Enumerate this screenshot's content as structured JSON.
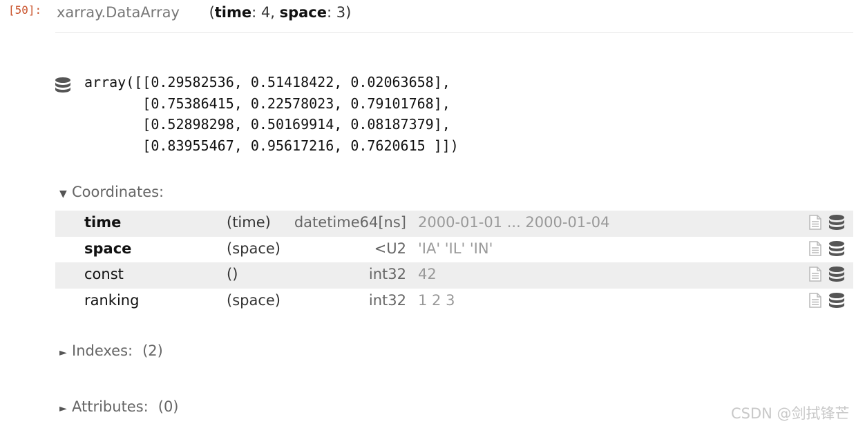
{
  "cell": {
    "prompt": "[50]:"
  },
  "header": {
    "object_type": "xarray.DataArray",
    "dims_open": "(",
    "dim1_name": "time",
    "dim1_size": ": 4, ",
    "dim2_name": "space",
    "dim2_size": ": 3)"
  },
  "array_preview": {
    "text": "array([[0.29582536, 0.51418422, 0.02063658],\n       [0.75386415, 0.22578023, 0.79101768],\n       [0.52898298, 0.50169914, 0.08187379],\n       [0.83955467, 0.95617216, 0.7620615 ]])",
    "icon": "database-icon"
  },
  "sections": {
    "coordinates": {
      "label": "Coordinates:",
      "arrow": "▼",
      "expanded": true
    },
    "indexes": {
      "label": "Indexes:",
      "arrow": "►",
      "count": "(2)"
    },
    "attributes": {
      "label": "Attributes:",
      "arrow": "►",
      "count": "(0)"
    }
  },
  "coordinates": [
    {
      "name": "time",
      "is_index": true,
      "dims": "(time)",
      "dtype": "datetime64[ns]",
      "preview": "2000-01-01 ... 2000-01-04"
    },
    {
      "name": "space",
      "is_index": true,
      "dims": "(space)",
      "dtype": "<U2",
      "preview": "'IA' 'IL' 'IN'"
    },
    {
      "name": "const",
      "is_index": false,
      "dims": "()",
      "dtype": "int32",
      "preview": "42"
    },
    {
      "name": "ranking",
      "is_index": false,
      "dims": "(space)",
      "dtype": "int32",
      "preview": "1 2 3"
    }
  ],
  "row_icons": [
    "file-text-icon",
    "database-icon"
  ],
  "watermark": "CSDN @剑拭锋芒",
  "colors": {
    "prompt": "#c9522b",
    "row_shade": "#eeeeee",
    "icon": "#555555",
    "icon_light": "#b8b8b8"
  }
}
